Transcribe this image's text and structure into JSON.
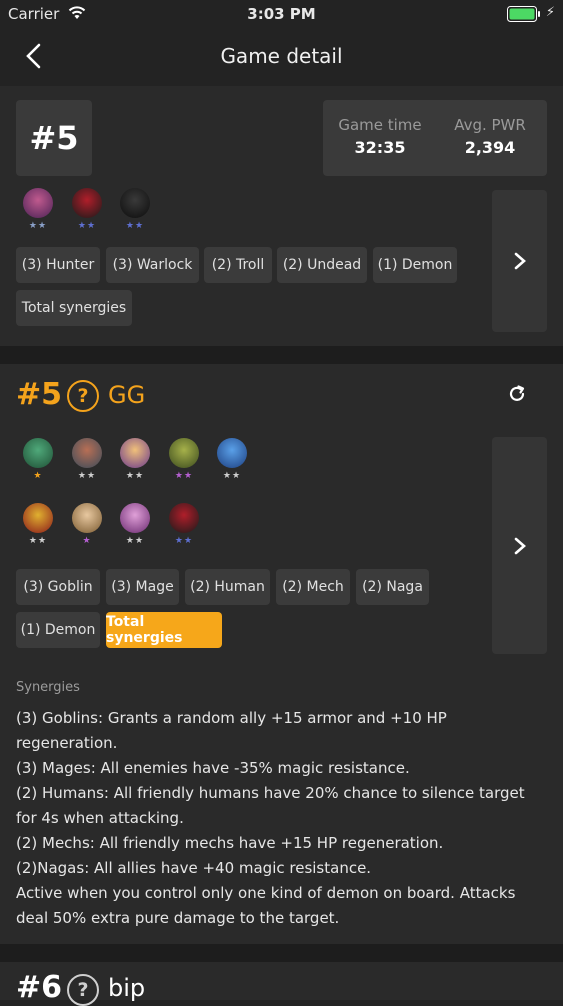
{
  "status_bar": {
    "carrier": "Carrier",
    "time": "3:03 PM"
  },
  "nav": {
    "title": "Game detail"
  },
  "summary": {
    "rank": "#5",
    "game_time_label": "Game time",
    "game_time": "32:35",
    "avg_pwr_label": "Avg. PWR",
    "avg_pwr": "2,394",
    "units": [
      {
        "name": "warlock-unit",
        "stars": "★★"
      },
      {
        "name": "demon-unit",
        "stars": "★★"
      },
      {
        "name": "undead-unit",
        "stars": "★★"
      }
    ],
    "chips": [
      "(3) Hunter",
      "(3) Warlock",
      "(2) Troll",
      "(2) Undead",
      "(1) Demon",
      "Total synergies"
    ]
  },
  "player": {
    "rank": "#5",
    "help_glyph": "?",
    "name": "GG",
    "units": [
      {
        "name": "goblin-unit-1",
        "stars": "★"
      },
      {
        "name": "mech-unit",
        "stars": "★★"
      },
      {
        "name": "mage-unit",
        "stars": "★★"
      },
      {
        "name": "goblin-unit-2",
        "stars": "★★"
      },
      {
        "name": "naga-unit",
        "stars": "★★"
      },
      {
        "name": "human-unit",
        "stars": "★★"
      },
      {
        "name": "mage-unit-2",
        "stars": "★"
      },
      {
        "name": "warlock-unit-2",
        "stars": "★★"
      },
      {
        "name": "demon-unit-2",
        "stars": "★★"
      }
    ],
    "chips": [
      "(3) Goblin",
      "(3) Mage",
      "(2) Human",
      "(2) Mech",
      "(2) Naga",
      "(1) Demon",
      "Total synergies"
    ],
    "synergies_label": "Synergies",
    "synergies": [
      "(3) Goblins: Grants a random ally +15 armor and +10 HP regeneration.",
      "(3) Mages: All enemies have -35% magic resistance.",
      "(2) Humans: All friendly humans have 20% chance to silence target for 4s when attacking.",
      "(2) Mechs: All friendly mechs have +15 HP regeneration.",
      "(2)Nagas: All allies have +40 magic resistance.",
      "Active when you control only one kind of demon on board. Attacks deal 50% extra pure damage to the target."
    ]
  },
  "next_player": {
    "rank": "#6",
    "help_glyph": "?",
    "name": "bip"
  },
  "colors": {
    "accent": "#f4a31c",
    "background": "#232323",
    "card": "#3a3a3a"
  }
}
